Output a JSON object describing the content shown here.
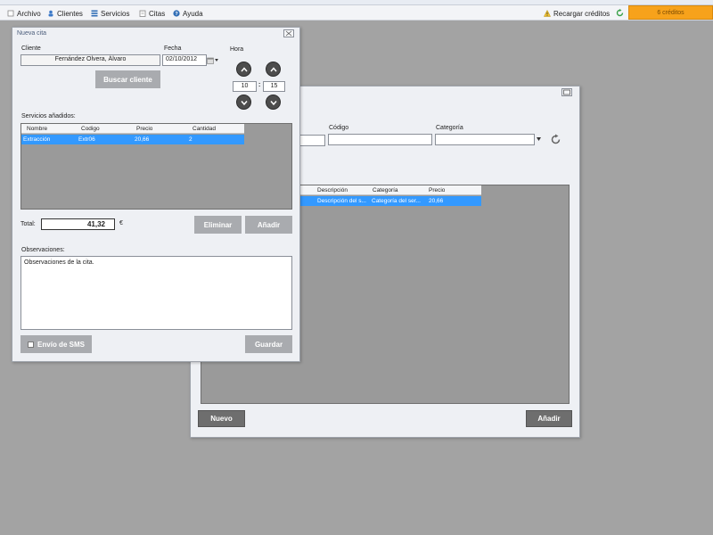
{
  "menu": {
    "items": [
      {
        "label": "Archivo",
        "icon": "file-icon"
      },
      {
        "label": "Clientes",
        "icon": "clients-icon"
      },
      {
        "label": "Servicios",
        "icon": "services-icon"
      },
      {
        "label": "Citas",
        "icon": "appointments-icon"
      },
      {
        "label": "Ayuda",
        "icon": "help-icon"
      }
    ],
    "recharge_label": "Recargar créditos",
    "credits_label": "6 créditos",
    "accent": "#f7a21b"
  },
  "services_window": {
    "code_label": "Código",
    "category_label": "Categoría",
    "code_value": "",
    "category_value": "",
    "table": {
      "headers": [
        "Descripción",
        "Categoría",
        "Precio"
      ],
      "rows": [
        [
          "Descripción del s...",
          "Categoría del ser...",
          "20,66"
        ]
      ]
    },
    "new_label": "Nuevo",
    "add_label": "Añadir"
  },
  "appointment_window": {
    "title": "Nueva cita",
    "client_label": "Cliente",
    "client_value": "Fernández Olvera, Álvaro",
    "date_label": "Fecha",
    "date_value": "02/10/2012",
    "time_label": "Hora",
    "hour_value": "10",
    "minute_value": "15",
    "time_separator": ":",
    "search_client_label": "Buscar cliente",
    "services_added_label": "Servicios añadidos:",
    "table": {
      "headers": [
        "Nombre",
        "Codigo",
        "Precio",
        "Cantidad"
      ],
      "rows": [
        [
          "Extracción",
          "Extr06",
          "20,66",
          "2"
        ]
      ]
    },
    "total_label": "Total:",
    "total_value": "41,32",
    "currency": "€",
    "remove_label": "Eliminar",
    "add_label": "Añadir",
    "notes_label": "Observaciones:",
    "notes_value": "Observaciones de la cita.",
    "sms_label": "Envío de SMS",
    "save_label": "Guardar"
  }
}
